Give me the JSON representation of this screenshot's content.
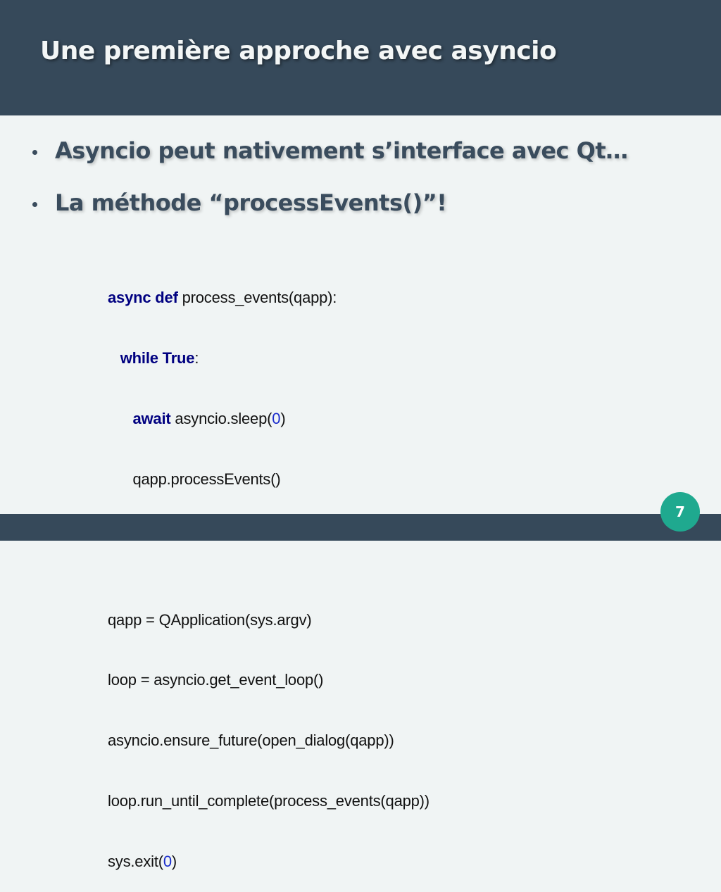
{
  "slide": {
    "title": "Une première approche avec asyncio",
    "page_number": "7"
  },
  "bullets": [
    "Asyncio peut nativement s’interface avec Qt…",
    "La méthode “processEvents()”!"
  ],
  "code": {
    "l1": {
      "kw": "async def",
      "rest": " process_events(qapp):"
    },
    "l2": {
      "indent": "   ",
      "kw": "while True",
      "rest": ":"
    },
    "l3": {
      "indent": "      ",
      "kw": "await",
      "pre": " asyncio.sleep(",
      "num": "0",
      "post": ")"
    },
    "l4": {
      "indent": "      ",
      "text": "qapp.processEvents()"
    },
    "l5": {
      "text": "qapp = QApplication(sys.argv)"
    },
    "l6": {
      "text": "loop = asyncio.get_event_loop()"
    },
    "l7": {
      "text": "asyncio.ensure_future(open_dialog(qapp))"
    },
    "l8": {
      "text": "loop.run_until_complete(process_events(qapp))"
    },
    "l9": {
      "pre": "sys.exit(",
      "num": "0",
      "post": ")"
    }
  },
  "colors": {
    "header_bg": "#36495a",
    "body_bg": "#f0f4f4",
    "keyword": "#000080",
    "number": "#1a2ccc",
    "badge": "#1fa98f"
  }
}
